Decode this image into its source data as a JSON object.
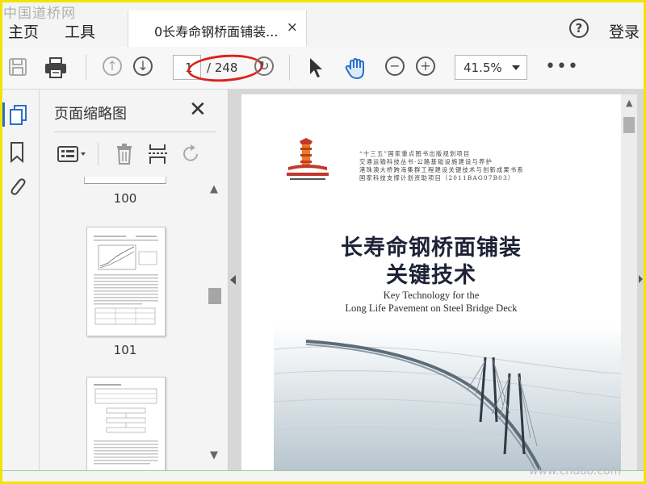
{
  "watermark": "中国道桥网",
  "menubar": {
    "home": "主页",
    "tools": "工具",
    "tab_title": "0长寿命钢桥面铺装...",
    "tab_close": "×",
    "help": "?",
    "login": "登录"
  },
  "toolbar": {
    "current_page": "1",
    "page_total": "/ 248",
    "zoom": "41.5%",
    "more": "•••",
    "highlight_color": "#d9231e"
  },
  "panel": {
    "title": "页面缩略图",
    "close": "✕",
    "thumbnails": [
      {
        "number": "100"
      },
      {
        "number": "101"
      },
      {
        "number": ""
      }
    ]
  },
  "document": {
    "publisher_lines": [
      "“十三五”国家重点图书出版规划项目",
      "交通运输科技丛书·公路基础设施建设与养护",
      "港珠澳大桥跨海集群工程建设关键技术与创新成果书系",
      "国家科技支撑计划资助项目（2011BAG07B03）"
    ],
    "title_line1": "长寿命钢桥面铺装",
    "title_line2": "关键技术",
    "english_line1": "Key Technology for the",
    "english_line2": "Long Life Pavement on Steel Bridge Deck"
  },
  "site_mark": "www.cndao.com"
}
